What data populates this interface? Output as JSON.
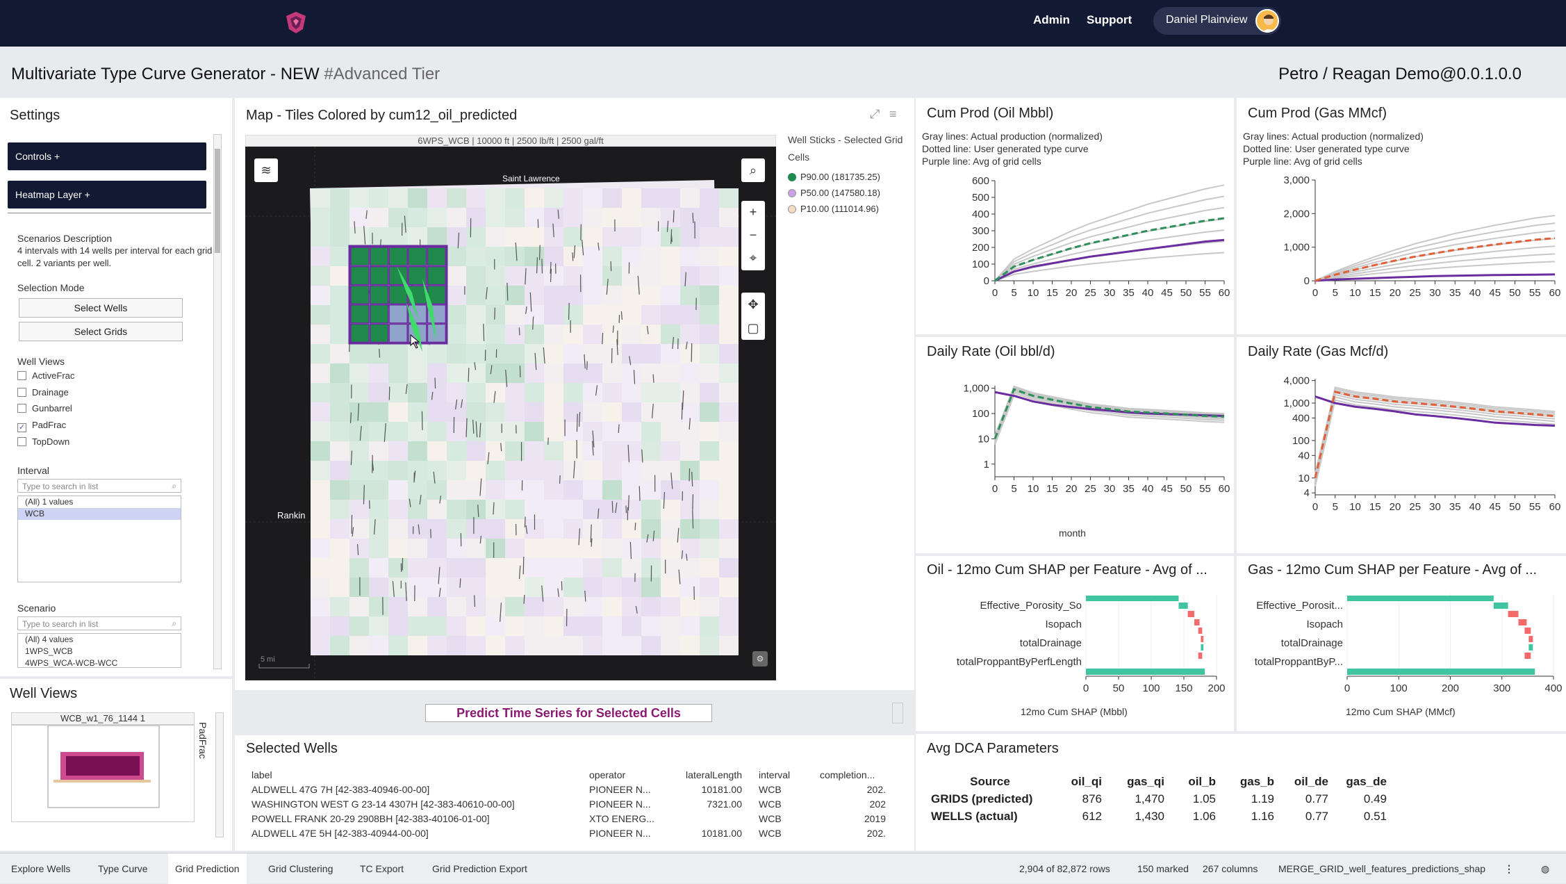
{
  "topbar": {
    "nav": [
      "Admin",
      "Support"
    ],
    "user_name": "Daniel Plainview"
  },
  "header": {
    "title": "Multivariate Type Curve Generator - NEW",
    "tier": "#Advanced Tier",
    "context": "Petro / Reagan Demo@0.0.1.0.0"
  },
  "settings": {
    "title": "Settings",
    "controls_label": "Controls +",
    "heatmap_label": "Heatmap Layer +",
    "scenarios_heading": "Scenarios Description",
    "scenarios_text": "4 intervals with 14 wells per interval for each grid cell. 2 variants per well.",
    "selection_mode_heading": "Selection Mode",
    "select_wells": "Select Wells",
    "select_grids": "Select Grids",
    "well_views_heading": "Well Views",
    "well_views": [
      {
        "label": "ActiveFrac",
        "checked": false
      },
      {
        "label": "Drainage",
        "checked": false
      },
      {
        "label": "Gunbarrel",
        "checked": false
      },
      {
        "label": "PadFrac",
        "checked": true
      },
      {
        "label": "TopDown",
        "checked": false
      }
    ],
    "interval_heading": "Interval",
    "interval_placeholder": "Type to search in list",
    "interval_items": [
      "(All) 1 values",
      "WCB"
    ],
    "scenario_heading": "Scenario",
    "scenario_placeholder": "Type to search in list",
    "scenario_items": [
      "(All) 4 values",
      "1WPS_WCB",
      "4WPS_WCA-WCB-WCC"
    ]
  },
  "well_views_panel": {
    "title": "Well Views",
    "thumb_title": "WCB_w1_76_1144 1",
    "side_label": "PadFrac"
  },
  "map": {
    "title": "Map - Tiles Colored by cum12_oil_predicted",
    "subtitle": "6WPS_WCB | 10000 ft | 2500 lb/ft | 2500 gal/ft",
    "place_labels": [
      "Saint Lawrence",
      "Rankin"
    ],
    "scale": "5 mi",
    "legend_title": "Well Sticks - Selected Grid Cells",
    "legend": [
      {
        "label": "P90.00 (181735.25)",
        "color": "#1e8a4c"
      },
      {
        "label": "P50.00 (147580.18)",
        "color": "#c9a0e8"
      },
      {
        "label": "P10.00 (111014.96)",
        "color": "#f6dcc4"
      }
    ],
    "predict_button": "Predict Time Series for Selected Cells"
  },
  "charts": {
    "cum_oil": {
      "title": "Cum Prod (Oil Mbbl)",
      "notes": [
        "Gray lines: Actual production (normalized)",
        "Dotted line: User generated type curve",
        "Purple line: Avg of grid cells"
      ]
    },
    "cum_gas": {
      "title": "Cum Prod (Gas MMcf)",
      "notes": [
        "Gray lines: Actual production (normalized)",
        "Dotted line: User generated type curve",
        "Purple line: Avg of grid cells"
      ]
    },
    "rate_oil": {
      "title": "Daily Rate (Oil bbl/d)",
      "xlabel": "month"
    },
    "rate_gas": {
      "title": "Daily Rate (Gas Mcf/d)"
    },
    "shap_oil": {
      "title": "Oil - 12mo Cum SHAP per Feature - Avg of ...",
      "xlabel": "12mo Cum SHAP (Mbbl)"
    },
    "shap_gas": {
      "title": "Gas - 12mo Cum SHAP per Feature - Avg of ...",
      "xlabel": "12mo Cum SHAP (MMcf)"
    }
  },
  "chart_data": [
    {
      "type": "line",
      "title": "Cum Prod (Oil Mbbl)",
      "x": [
        0,
        5,
        10,
        15,
        20,
        25,
        30,
        35,
        40,
        45,
        50,
        55,
        60
      ],
      "ylim": [
        0,
        600
      ],
      "series": [
        {
          "style": "dashed",
          "color": "#2f8f5a",
          "values": [
            0,
            85,
            125,
            160,
            195,
            225,
            250,
            275,
            300,
            320,
            340,
            360,
            375
          ]
        },
        {
          "style": "solid",
          "color": "#6a2c9e",
          "values": [
            0,
            55,
            85,
            105,
            125,
            145,
            160,
            175,
            190,
            205,
            220,
            235,
            245
          ]
        }
      ]
    },
    {
      "type": "line",
      "title": "Cum Prod (Gas MMcf)",
      "x": [
        0,
        5,
        10,
        15,
        20,
        25,
        30,
        35,
        40,
        45,
        50,
        55,
        60
      ],
      "ylim": [
        0,
        3000
      ],
      "series": [
        {
          "style": "dashed",
          "color": "#e0603a",
          "values": [
            0,
            180,
            330,
            470,
            600,
            720,
            820,
            920,
            1000,
            1080,
            1150,
            1220,
            1270
          ]
        },
        {
          "style": "solid",
          "color": "#6a2c9e",
          "values": [
            0,
            40,
            60,
            80,
            100,
            120,
            140,
            150,
            160,
            170,
            175,
            180,
            190
          ]
        }
      ]
    },
    {
      "type": "line",
      "title": "Daily Rate (Oil bbl/d)",
      "xlabel": "month",
      "scale": "log",
      "x": [
        0,
        5,
        10,
        15,
        20,
        25,
        30,
        35,
        40,
        45,
        50,
        55,
        60
      ],
      "series": [
        {
          "style": "dashed",
          "color": "#2f8f5a",
          "values": [
            10,
            900,
            500,
            350,
            250,
            180,
            150,
            120,
            110,
            100,
            90,
            80,
            75
          ]
        },
        {
          "style": "solid",
          "color": "#6a2c9e",
          "values": [
            700,
            500,
            300,
            220,
            180,
            150,
            130,
            110,
            100,
            95,
            90,
            85,
            80
          ]
        }
      ]
    },
    {
      "type": "line",
      "title": "Daily Rate (Gas Mcf/d)",
      "scale": "log",
      "x": [
        0,
        5,
        10,
        15,
        20,
        25,
        30,
        35,
        40,
        45,
        50,
        55,
        60
      ],
      "series": [
        {
          "style": "dashed",
          "color": "#e0603a",
          "values": [
            10,
            2000,
            1500,
            1300,
            1100,
            1000,
            900,
            800,
            700,
            600,
            550,
            500,
            450
          ]
        },
        {
          "style": "solid",
          "color": "#6a2c9e",
          "values": [
            1500,
            1000,
            800,
            700,
            600,
            500,
            450,
            400,
            350,
            300,
            280,
            260,
            250
          ]
        }
      ]
    },
    {
      "type": "bar",
      "title": "Oil - 12mo Cum SHAP per Feature - Avg of ...",
      "categories": [
        "Effective_Porosity_So",
        "Isopach",
        "totalDrainage",
        "totalProppantByPerfLength"
      ],
      "xlabel": "12mo Cum SHAP (Mbbl)",
      "xlim": [
        0,
        200
      ]
    },
    {
      "type": "bar",
      "title": "Gas - 12mo Cum SHAP per Feature - Avg of ...",
      "categories": [
        "Effective_Porosit...",
        "Isopach",
        "totalDrainage",
        "totalProppantByP..."
      ],
      "xlabel": "12mo Cum SHAP (MMcf)",
      "xlim": [
        0,
        400
      ]
    }
  ],
  "selected_wells": {
    "title": "Selected Wells",
    "columns": [
      "label",
      "operator",
      "lateralLength",
      "interval",
      "completion..."
    ],
    "rows": [
      [
        "ALDWELL 47G 7H [42-383-40946-00-00]",
        "PIONEER N...",
        "10181.00",
        "WCB",
        "202."
      ],
      [
        "WASHINGTON WEST G 23-14 4307H [42-383-40610-00-00]",
        "PIONEER N...",
        "7321.00",
        "WCB",
        "202"
      ],
      [
        "POWELL FRANK 20-29 2908BH [42-383-40106-01-00]",
        "XTO ENERG...",
        "",
        "WCB",
        "2019"
      ],
      [
        "ALDWELL 47E 5H [42-383-40944-00-00]",
        "PIONEER N...",
        "10181.00",
        "WCB",
        "202."
      ]
    ]
  },
  "dca": {
    "title": "Avg DCA Parameters",
    "columns": [
      "Source",
      "oil_qi",
      "gas_qi",
      "oil_b",
      "gas_b",
      "oil_de",
      "gas_de"
    ],
    "rows": [
      [
        "GRIDS (predicted)",
        "876",
        "1,470",
        "1.05",
        "1.19",
        "0.77",
        "0.49"
      ],
      [
        "WELLS (actual)",
        "612",
        "1,430",
        "1.06",
        "1.16",
        "0.77",
        "0.51"
      ]
    ]
  },
  "tabs": [
    "Explore Wells",
    "Type Curve",
    "Grid Prediction",
    "Grid Clustering",
    "TC Export",
    "Grid Prediction Export"
  ],
  "active_tab": "Grid Prediction",
  "status": {
    "rows": "2,904 of 82,872 rows",
    "marked": "150 marked",
    "columns": "267 columns",
    "table": "MERGE_GRID_well_features_predictions_shap"
  }
}
